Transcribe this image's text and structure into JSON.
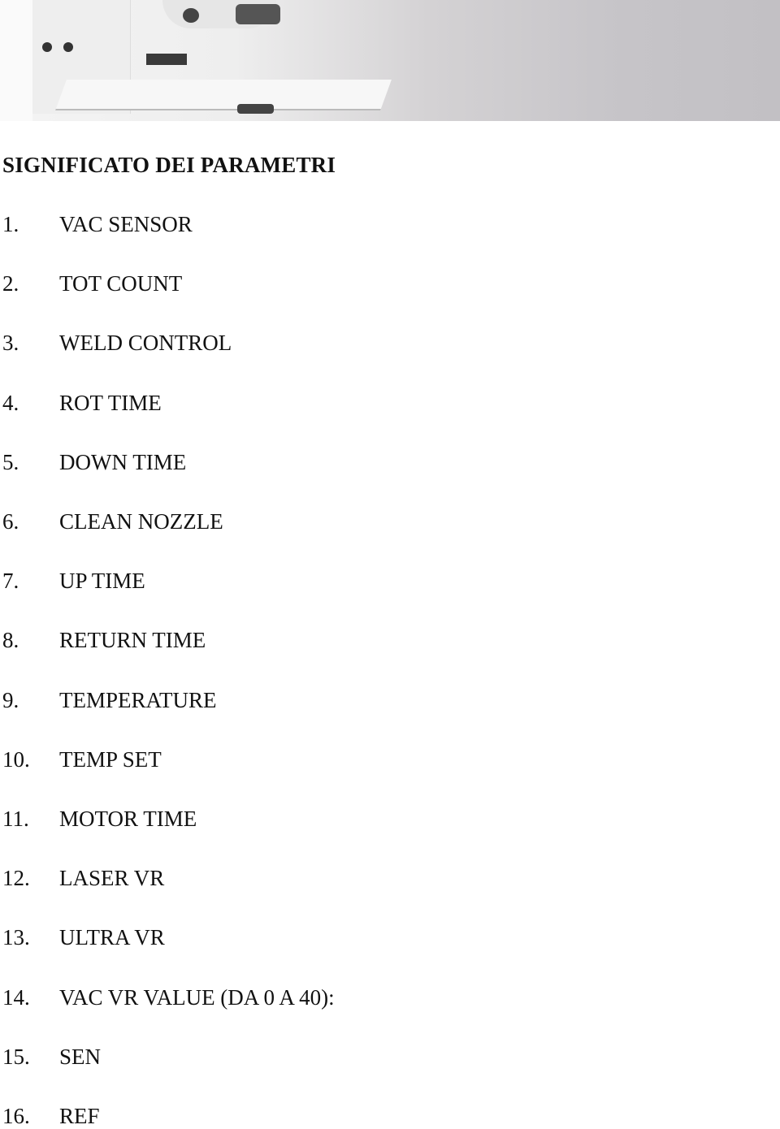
{
  "banner": {
    "image_alt": "machine photo"
  },
  "heading": "SIGNIFICATO DEI PARAMETRI",
  "items": [
    {
      "num": "1.",
      "label": "VAC SENSOR"
    },
    {
      "num": "2.",
      "label": "TOT COUNT"
    },
    {
      "num": "3.",
      "label": "WELD CONTROL"
    },
    {
      "num": "4.",
      "label": "ROT TIME"
    },
    {
      "num": "5.",
      "label": "DOWN TIME"
    },
    {
      "num": "6.",
      "label": "CLEAN NOZZLE"
    },
    {
      "num": "7.",
      "label": "UP TIME"
    },
    {
      "num": "8.",
      "label": "RETURN TIME"
    },
    {
      "num": "9.",
      "label": "TEMPERATURE"
    },
    {
      "num": "10.",
      "label": "TEMP SET"
    },
    {
      "num": "11.",
      "label": "MOTOR TIME"
    },
    {
      "num": "12.",
      "label": "LASER VR"
    },
    {
      "num": "13.",
      "label": "ULTRA VR"
    },
    {
      "num": "14.",
      "label": "VAC VR VALUE (DA 0 A 40):"
    },
    {
      "num": "15.",
      "label": "SEN"
    },
    {
      "num": "16.",
      "label": "REF"
    }
  ]
}
